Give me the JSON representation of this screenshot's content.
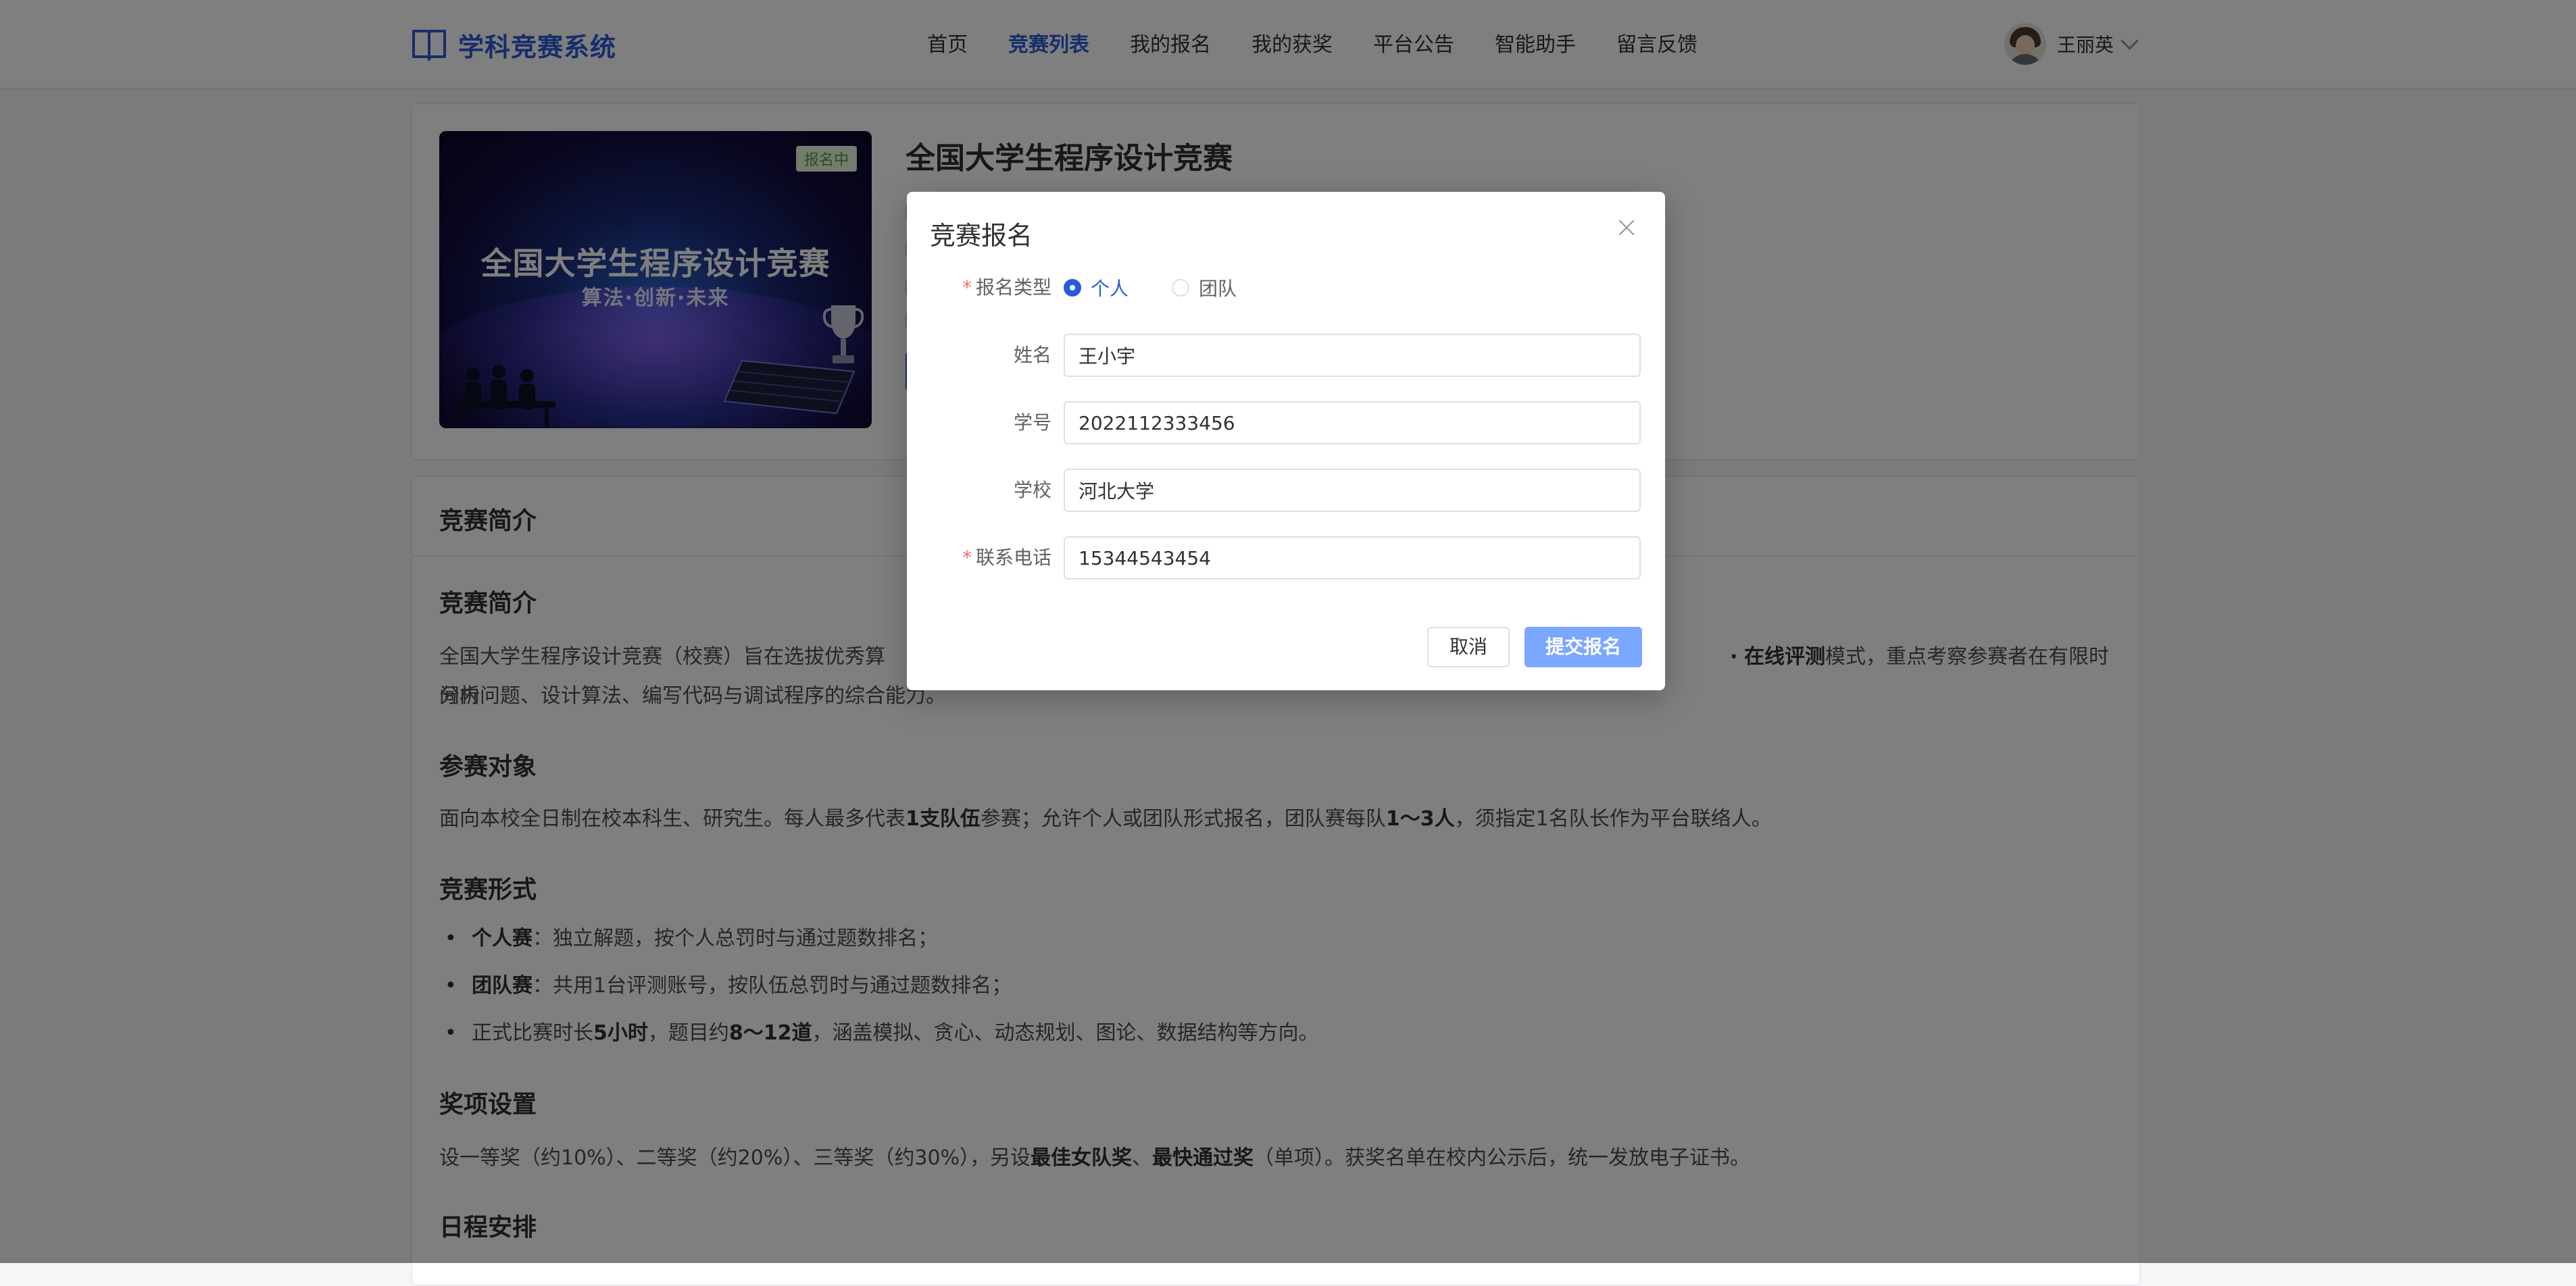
{
  "header": {
    "logo_text": "学科竞赛系统",
    "nav": [
      {
        "label": "首页",
        "active": false
      },
      {
        "label": "竞赛列表",
        "active": true
      },
      {
        "label": "我的报名",
        "active": false
      },
      {
        "label": "我的获奖",
        "active": false
      },
      {
        "label": "平台公告",
        "active": false
      },
      {
        "label": "智能助手",
        "active": false
      },
      {
        "label": "留言反馈",
        "active": false
      }
    ],
    "user_name": "王丽英"
  },
  "detail": {
    "title": "全国大学生程序设计竞赛",
    "cover_title": "全国大学生程序设计竞赛",
    "cover_subtitle": "算法·创新·未来",
    "status_badge": "报名中"
  },
  "intro": {
    "card_title": "竞赛简介",
    "sections": {
      "s1_title": "竞赛简介",
      "s1_p1": "全国大学生程序设计竞赛（校赛）旨在选拔优秀算",
      "s1_bold": "在线评测",
      "s1_p2": "模式，重点考察参赛者在有限时间内",
      "s1_line2": "分析问题、设计算法、编写代码与调试程序的综合能力。",
      "s2_title": "参赛对象",
      "s2_p1": "面向本校全日制在校本科生、研究生。每人最多代表",
      "s2_b1": "1支队伍",
      "s2_p2": "参赛；允许个人或团队形式报名，团队赛每队",
      "s2_b2": "1～3人",
      "s2_p3": "，须指定1名队长作为平台联络人。",
      "s3_title": "竞赛形式",
      "s3_items": [
        {
          "bold": "个人赛",
          "text": "：独立解题，按个人总罚时与通过题数排名；"
        },
        {
          "bold": "团队赛",
          "text": "：共用1台评测账号，按队伍总罚时与通过题数排名；"
        }
      ],
      "s3_item3_p1": "正式比赛时长",
      "s3_item3_b1": "5小时",
      "s3_item3_p2": "，题目约",
      "s3_item3_b2": "8～12道",
      "s3_item3_p3": "，涵盖模拟、贪心、动态规划、图论、数据结构等方向。",
      "s4_title": "奖项设置",
      "s4_p1": "设一等奖（约10%）、二等奖（约20%）、三等奖（约30%），另设",
      "s4_b1": "最佳女队奖",
      "s4_sep": "、",
      "s4_b2": "最快通过奖",
      "s4_p2": "（单项）。获奖名单在校内公示后，统一发放电子证书。",
      "s5_title": "日程安排"
    }
  },
  "modal": {
    "title": "竞赛报名",
    "type_label": "报名类型",
    "type_options": [
      "个人",
      "团队"
    ],
    "type_selected": "个人",
    "name_label": "姓名",
    "name_value": "王小宇",
    "student_id_label": "学号",
    "student_id_value": "2022112333456",
    "school_label": "学校",
    "school_value": "河北大学",
    "phone_label": "联系电话",
    "phone_value": "15344543454",
    "cancel_label": "取消",
    "submit_label": "提交报名"
  },
  "colors": {
    "primary": "#2a5bd7",
    "submit_button": "#7aa7ff",
    "required_star": "#f56c6c",
    "badge_bg": "#e8f7df",
    "badge_text": "#5a9d3b"
  }
}
